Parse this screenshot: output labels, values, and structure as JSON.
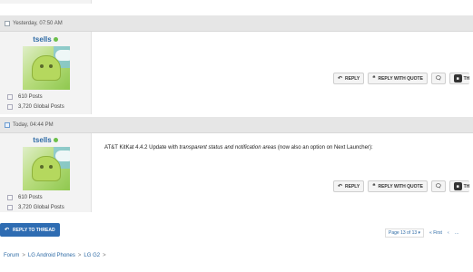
{
  "posts": [
    {
      "date": "Yesterday, 07:50 AM",
      "username": "tsells",
      "posts_count": "610 Posts",
      "global_posts": "3,720 Global Posts",
      "content_prefix": "",
      "content_italic": "",
      "content_suffix": "",
      "actions": {
        "reply": "REPLY",
        "reply_quote": "REPLY WITH QUOTE",
        "thanks": "TH"
      }
    },
    {
      "date": "Today, 04:44 PM",
      "username": "tsells",
      "posts_count": "610 Posts",
      "global_posts": "3,720 Global Posts",
      "content_prefix": "AT&T KitKat 4.4.2 Update with ",
      "content_italic": "transparent status and notification areas",
      "content_suffix": " (now also an option on Next Launcher):",
      "actions": {
        "reply": "REPLY",
        "reply_quote": "REPLY WITH QUOTE",
        "thanks": "TH"
      }
    }
  ],
  "reply_to_thread": "REPLY TO THREAD",
  "pager": {
    "page": "Page 13 of 13",
    "first": "First"
  },
  "breadcrumb": [
    "Forum",
    "LG Android Phones",
    "LG G2"
  ],
  "colors": {
    "accent": "#2e6cb2",
    "link": "#2d6aa5",
    "online": "#6cbf4a"
  }
}
